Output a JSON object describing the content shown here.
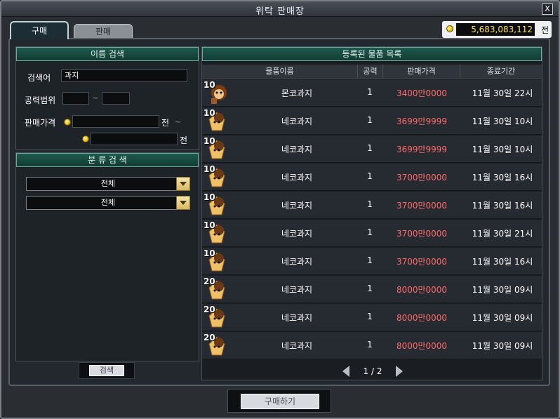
{
  "window": {
    "title": "위탁 판매장",
    "close_label": "X"
  },
  "tabs": {
    "buy": "구매",
    "sell": "판매"
  },
  "money": {
    "amount": "5,683,083,112",
    "unit": "전"
  },
  "name_search": {
    "header": "이름 검색",
    "keyword_label": "검색어",
    "keyword_value": "과지",
    "attack_label": "공력범위",
    "tilde": "~",
    "price_label": "판매가격",
    "price_unit": "전"
  },
  "category_search": {
    "header": "분 류 검 색",
    "dropdown1": "전체",
    "dropdown2": "전체"
  },
  "search_button": "검색",
  "list": {
    "header": "등록된 물품 목록",
    "columns": {
      "name": "물품이름",
      "attack": "공력",
      "price": "판매가격",
      "end": "종료기간"
    },
    "rows": [
      {
        "qty": "10",
        "name": "몬코과지",
        "level": "1",
        "price": "3400만0000",
        "date": "11월 30일 22시"
      },
      {
        "qty": "10",
        "name": "네코과지",
        "level": "1",
        "price": "3699만9999",
        "date": "11월 30일 10시"
      },
      {
        "qty": "10",
        "name": "네코과지",
        "level": "1",
        "price": "3699만9999",
        "date": "11월 30일 10시"
      },
      {
        "qty": "10",
        "name": "네코과지",
        "level": "1",
        "price": "3700만0000",
        "date": "11월 30일 16시"
      },
      {
        "qty": "10",
        "name": "네코과지",
        "level": "1",
        "price": "3700만0000",
        "date": "11월 30일 16시"
      },
      {
        "qty": "10",
        "name": "네코과지",
        "level": "1",
        "price": "3700만0000",
        "date": "11월 30일 21시"
      },
      {
        "qty": "10",
        "name": "네코과지",
        "level": "1",
        "price": "3700만0000",
        "date": "11월 30일 16시"
      },
      {
        "qty": "20",
        "name": "네코과지",
        "level": "1",
        "price": "8000만0000",
        "date": "11월 30일 09시"
      },
      {
        "qty": "20",
        "name": "네코과지",
        "level": "1",
        "price": "8000만0000",
        "date": "11월 30일 09시"
      },
      {
        "qty": "20",
        "name": "네코과지",
        "level": "1",
        "price": "8000만0000",
        "date": "11월 30일 09시"
      }
    ],
    "page": "1 / 2"
  },
  "buy_button": "구매하기"
}
